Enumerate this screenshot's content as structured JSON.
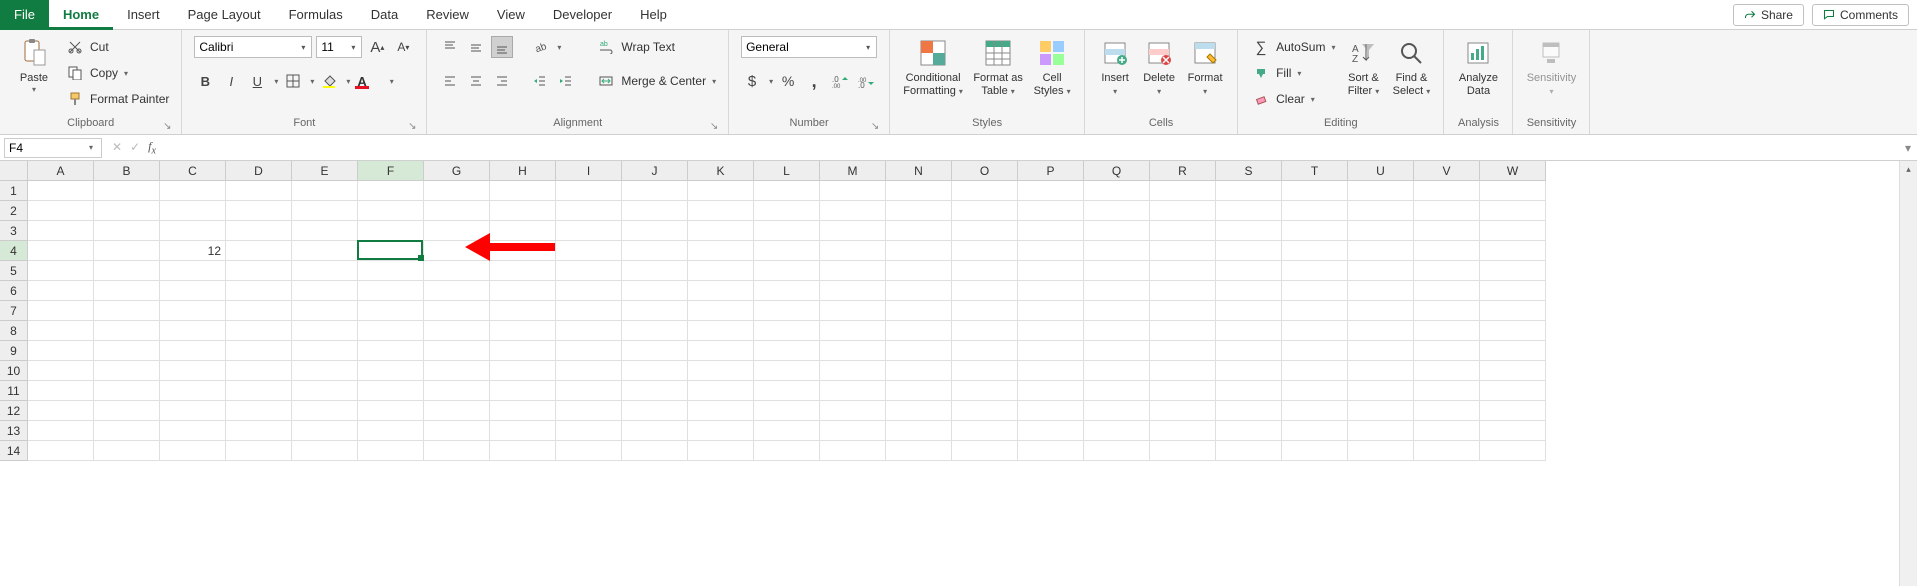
{
  "tabs": [
    "File",
    "Home",
    "Insert",
    "Page Layout",
    "Formulas",
    "Data",
    "Review",
    "View",
    "Developer",
    "Help"
  ],
  "active_tab": "Home",
  "top_right": {
    "share": "Share",
    "comments": "Comments"
  },
  "clipboard": {
    "paste": "Paste",
    "cut": "Cut",
    "copy": "Copy",
    "format_painter": "Format Painter",
    "group_label": "Clipboard"
  },
  "font": {
    "name": "Calibri",
    "size": "11",
    "increase": "A",
    "decrease": "A",
    "bold": "B",
    "italic": "I",
    "underline": "U",
    "group_label": "Font"
  },
  "alignment": {
    "wrap": "Wrap Text",
    "merge": "Merge & Center",
    "group_label": "Alignment"
  },
  "number": {
    "format": "General",
    "group_label": "Number"
  },
  "styles": {
    "conditional": "Conditional Formatting",
    "table": "Format as Table",
    "cell": "Cell Styles",
    "group_label": "Styles"
  },
  "cells_group": {
    "insert": "Insert",
    "delete": "Delete",
    "format": "Format",
    "group_label": "Cells"
  },
  "editing": {
    "autosum": "AutoSum",
    "fill": "Fill",
    "clear": "Clear",
    "sort": "Sort & Filter",
    "find": "Find & Select",
    "group_label": "Editing"
  },
  "analysis": {
    "analyze": "Analyze Data",
    "group_label": "Analysis"
  },
  "sensitivity": {
    "label": "Sensitivity",
    "group_label": "Sensitivity"
  },
  "name_box": "F4",
  "formula_value": "",
  "columns": [
    "A",
    "B",
    "C",
    "D",
    "E",
    "F",
    "G",
    "H",
    "I",
    "J",
    "K",
    "L",
    "M",
    "N",
    "O",
    "P",
    "Q",
    "R",
    "S",
    "T",
    "U",
    "V",
    "W"
  ],
  "row_count": 14,
  "selected_col": "F",
  "selected_row": 4,
  "cells": {
    "C4": "12"
  }
}
